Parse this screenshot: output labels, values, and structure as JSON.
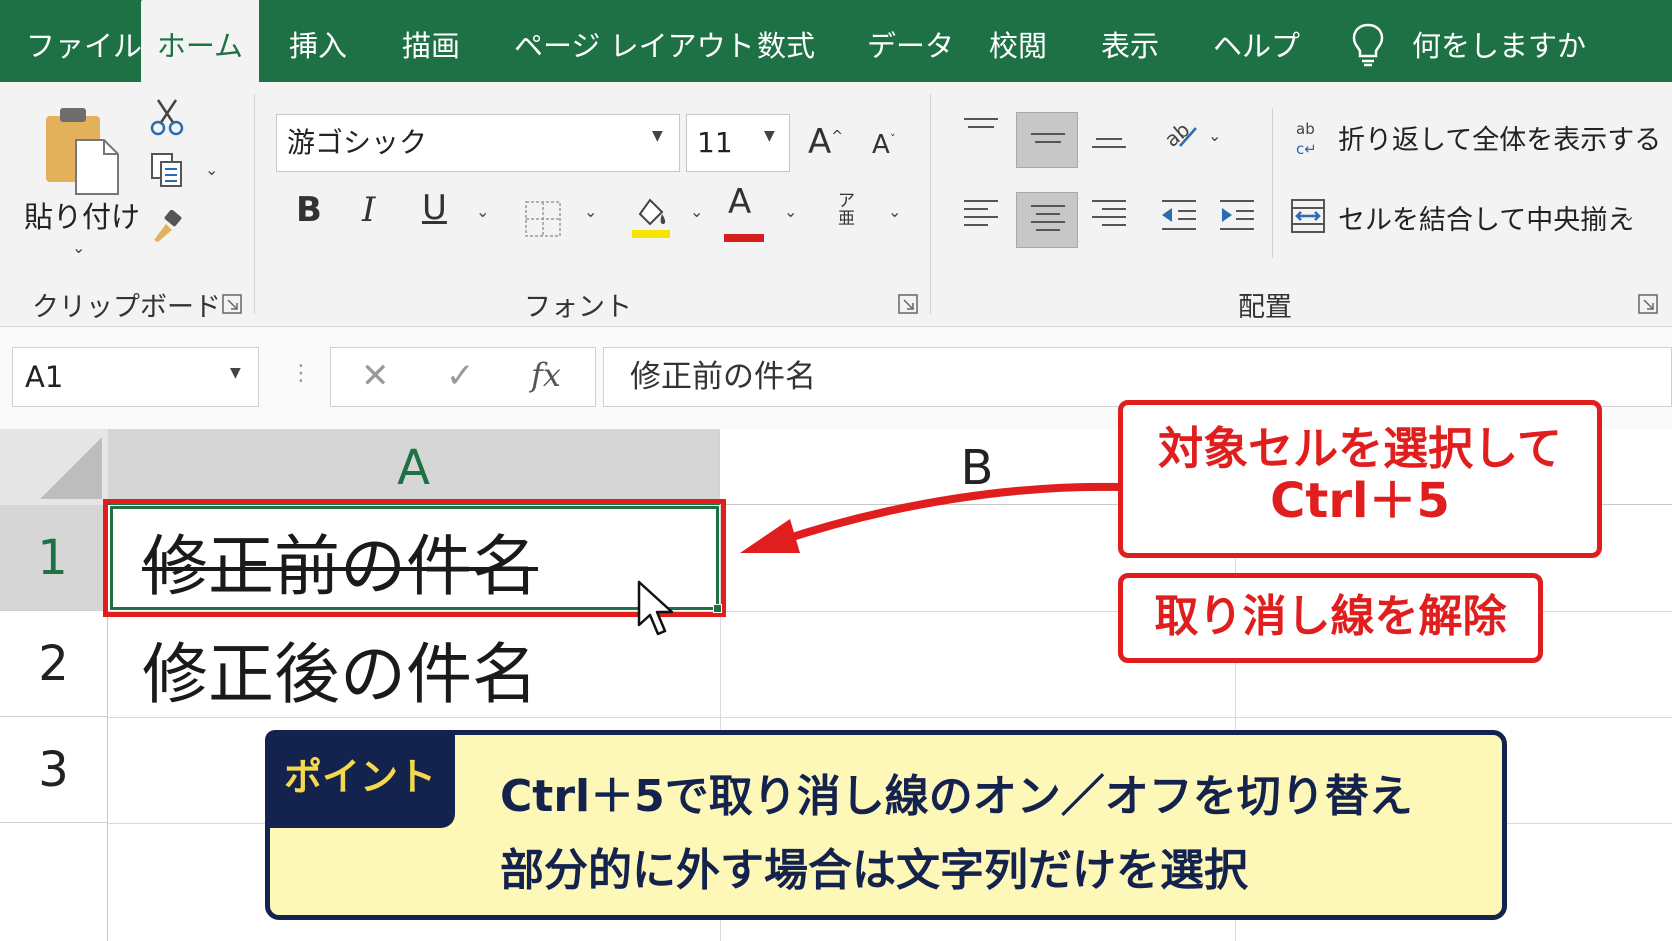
{
  "tabs": [
    {
      "label": "ファイル",
      "active": false
    },
    {
      "label": "ホーム",
      "active": true
    },
    {
      "label": "挿入",
      "active": false
    },
    {
      "label": "描画",
      "active": false
    },
    {
      "label": "ページ レイアウト",
      "active": false
    },
    {
      "label": "数式",
      "active": false
    },
    {
      "label": "データ",
      "active": false
    },
    {
      "label": "校閲",
      "active": false
    },
    {
      "label": "表示",
      "active": false
    },
    {
      "label": "ヘルプ",
      "active": false
    }
  ],
  "tell_me": "何をしますか",
  "clipboard": {
    "paste_label": "貼り付け",
    "group_label": "クリップボード"
  },
  "font": {
    "name": "游ゴシック",
    "size": "11",
    "bold": "B",
    "italic": "I",
    "underline": "U",
    "grow": "A",
    "shrink": "A",
    "font_color": "A",
    "phonetic": "ア\n亜",
    "group_label": "フォント",
    "highlight_color": "#f5e400",
    "font_color_hex": "#d41f1f"
  },
  "alignment": {
    "wrap_text": "折り返して全体を表示する",
    "merge_center": "セルを結合して中央揃え",
    "group_label": "配置"
  },
  "formula_bar": {
    "name_box": "A1",
    "fx": "fx",
    "content": "修正前の件名"
  },
  "sheet": {
    "columns": [
      "A",
      "B"
    ],
    "rows": [
      "1",
      "2",
      "3"
    ],
    "cells": {
      "A1": "修正前の件名",
      "A2": "修正後の件名"
    },
    "accent": "#1e7145"
  },
  "callouts": {
    "shortcut_line1": "対象セルを選択して",
    "shortcut_line2": "Ctrl＋5",
    "result": "取り消し線を解除"
  },
  "point": {
    "tag": "ポイント",
    "line1": "Ctrl＋5で取り消し線のオン／オフを切り替え",
    "line2": "部分的に外す場合は文字列だけを選択"
  }
}
